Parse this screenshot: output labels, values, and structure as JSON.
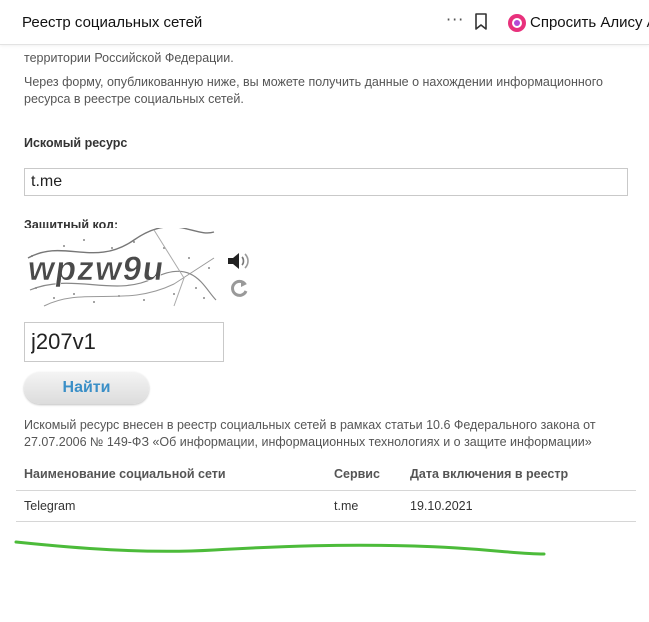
{
  "browser": {
    "page_title": "Реестр социальных сетей",
    "menu_dots": "···",
    "alice_label": "Спросить Алису А",
    "alice_color": "#e8317c"
  },
  "intro": {
    "line_cut": "территории Российской Федерации.",
    "paragraph": "Через форму, опубликованную ниже, вы можете получить данные о нахождении информационного ресурса в реестре социальных сетей."
  },
  "form": {
    "resource_label": "Искомый ресурс",
    "resource_value": "t.me",
    "captcha_label": "Защитный код:",
    "captcha_text": "wpzw9u",
    "code_value": "j207v1",
    "find_button": "Найти",
    "button_text_color": "#3a8fc7"
  },
  "result": {
    "message": "Искомый ресурс внесен в реестр социальных сетей в рамках статьи 10.6 Федерального закона от 27.07.2006 № 149-ФЗ «Об информации, информационных технологиях и о защите информации»",
    "table": {
      "headers": [
        "Наименование социальной сети",
        "Сервис",
        "Дата включения в реестр"
      ],
      "rows": [
        [
          "Telegram",
          "t.me",
          "19.10.2021"
        ]
      ]
    }
  },
  "annotation": {
    "marker_color": "#4cbb3a"
  }
}
